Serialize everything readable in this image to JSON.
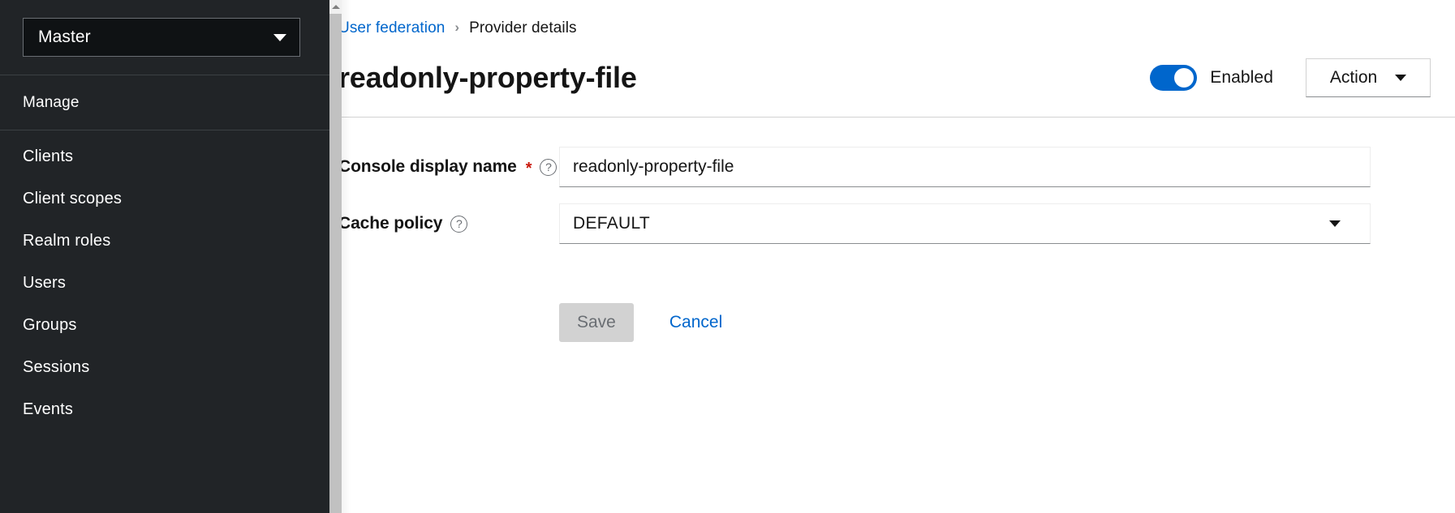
{
  "sidebar": {
    "realm_selector": {
      "value": "Master",
      "caret_icon": "chevron-down-icon"
    },
    "section_title": "Manage",
    "items": [
      {
        "label": "Clients"
      },
      {
        "label": "Client scopes"
      },
      {
        "label": "Realm roles"
      },
      {
        "label": "Users"
      },
      {
        "label": "Groups"
      },
      {
        "label": "Sessions"
      },
      {
        "label": "Events"
      }
    ]
  },
  "breadcrumb": {
    "parent": "User federation",
    "separator": "›",
    "current": "Provider details"
  },
  "header": {
    "title": "readonly-property-file",
    "enabled_toggle": {
      "label": "Enabled",
      "checked": true,
      "accent_color": "#0066cc"
    },
    "action_menu": {
      "label": "Action",
      "caret_icon": "caret-down-icon"
    }
  },
  "form": {
    "fields": [
      {
        "label": "Console display name",
        "required": true,
        "required_marker": "*",
        "help_icon": "help-circle-icon",
        "type": "text",
        "value": "readonly-property-file",
        "placeholder": ""
      },
      {
        "label": "Cache policy",
        "required": false,
        "required_marker": "",
        "help_icon": "help-circle-icon",
        "type": "select",
        "value": "DEFAULT",
        "placeholder": ""
      }
    ],
    "save_label": "Save",
    "save_disabled": true,
    "cancel_label": "Cancel"
  },
  "scrollbar": {
    "up_arrow_icon": "triangle-up-icon"
  },
  "colors": {
    "sidebar_bg": "#212427",
    "link_blue": "#0066cc",
    "required_red": "#c9190b",
    "disabled_grey": "#d2d2d2"
  }
}
